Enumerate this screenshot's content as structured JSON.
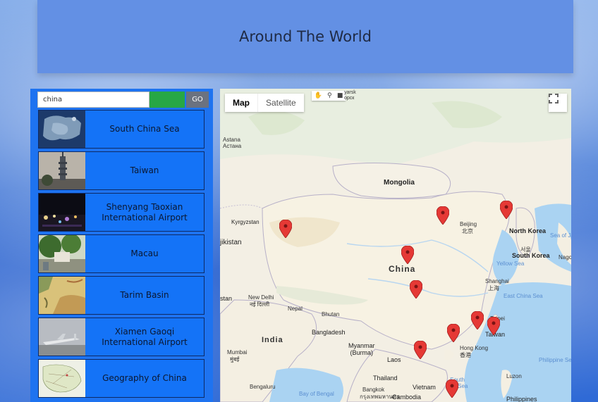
{
  "header": {
    "title": "Around The World"
  },
  "search": {
    "value": "china",
    "go_label": "GO"
  },
  "results": [
    {
      "label": "South China Sea"
    },
    {
      "label": "Taiwan"
    },
    {
      "label": "Shenyang Taoxian International Airport"
    },
    {
      "label": "Macau"
    },
    {
      "label": "Tarim Basin"
    },
    {
      "label": "Xiamen Gaoqi International Airport"
    },
    {
      "label": "Geography of China"
    }
  ],
  "map": {
    "tabs": {
      "map": "Map",
      "satellite": "Satellite"
    },
    "tools_text": "yarsk\nорск",
    "labels": {
      "mongolia": "Mongolia",
      "china": "China",
      "india": "India",
      "kyrgyzstan": "Kyrgyzstan",
      "tajikistan": "jikistan",
      "astana": "Astana",
      "astana_local": "Астана",
      "beijing": "Beijing",
      "beijing_local": "北京",
      "north_korea": "North Korea",
      "south_korea": "South Korea",
      "seoul": "서울",
      "sea_of_japan": "Sea of Ja",
      "yellow_sea": "Yellow Sea",
      "nagoya": "Nagoy",
      "shanghai": "Shanghai",
      "shanghai_local": "上海",
      "east_china_sea": "East China Sea",
      "taipei": "Taipei",
      "taiwan": "Taiwan",
      "hong_kong": "Hong Kong",
      "hong_kong_local": "香港",
      "new_delhi": "New Delhi",
      "new_delhi_local": "नई दिल्ली",
      "nepal": "Nepal",
      "bhutan": "Bhutan",
      "bangladesh": "Bangladesh",
      "myanmar": "Myanmar\n(Burma)",
      "laos": "Laos",
      "thailand": "Thailand",
      "bangkok": "Bangkok",
      "bangkok_local": "กรุงเทพมหานคร",
      "vietnam": "Vietnam",
      "cambodia": "Cambodia",
      "mumbai": "Mumbai",
      "mumbai_local": "मुंबई",
      "bengaluru": "Bengaluru",
      "bay_of_bengal": "Bay of Bengal",
      "south_china_sea_water": "South\nna Sea",
      "philippine_sea": "Philippine Sea",
      "luzon": "Luzon",
      "philippines": "Philippines",
      "stan": "stan"
    }
  },
  "colors": {
    "sidebar": "#1e73f0",
    "header": "#6390e4",
    "go_button": "#6b7280",
    "search_fill": "#27a745",
    "marker": "#e53935"
  }
}
